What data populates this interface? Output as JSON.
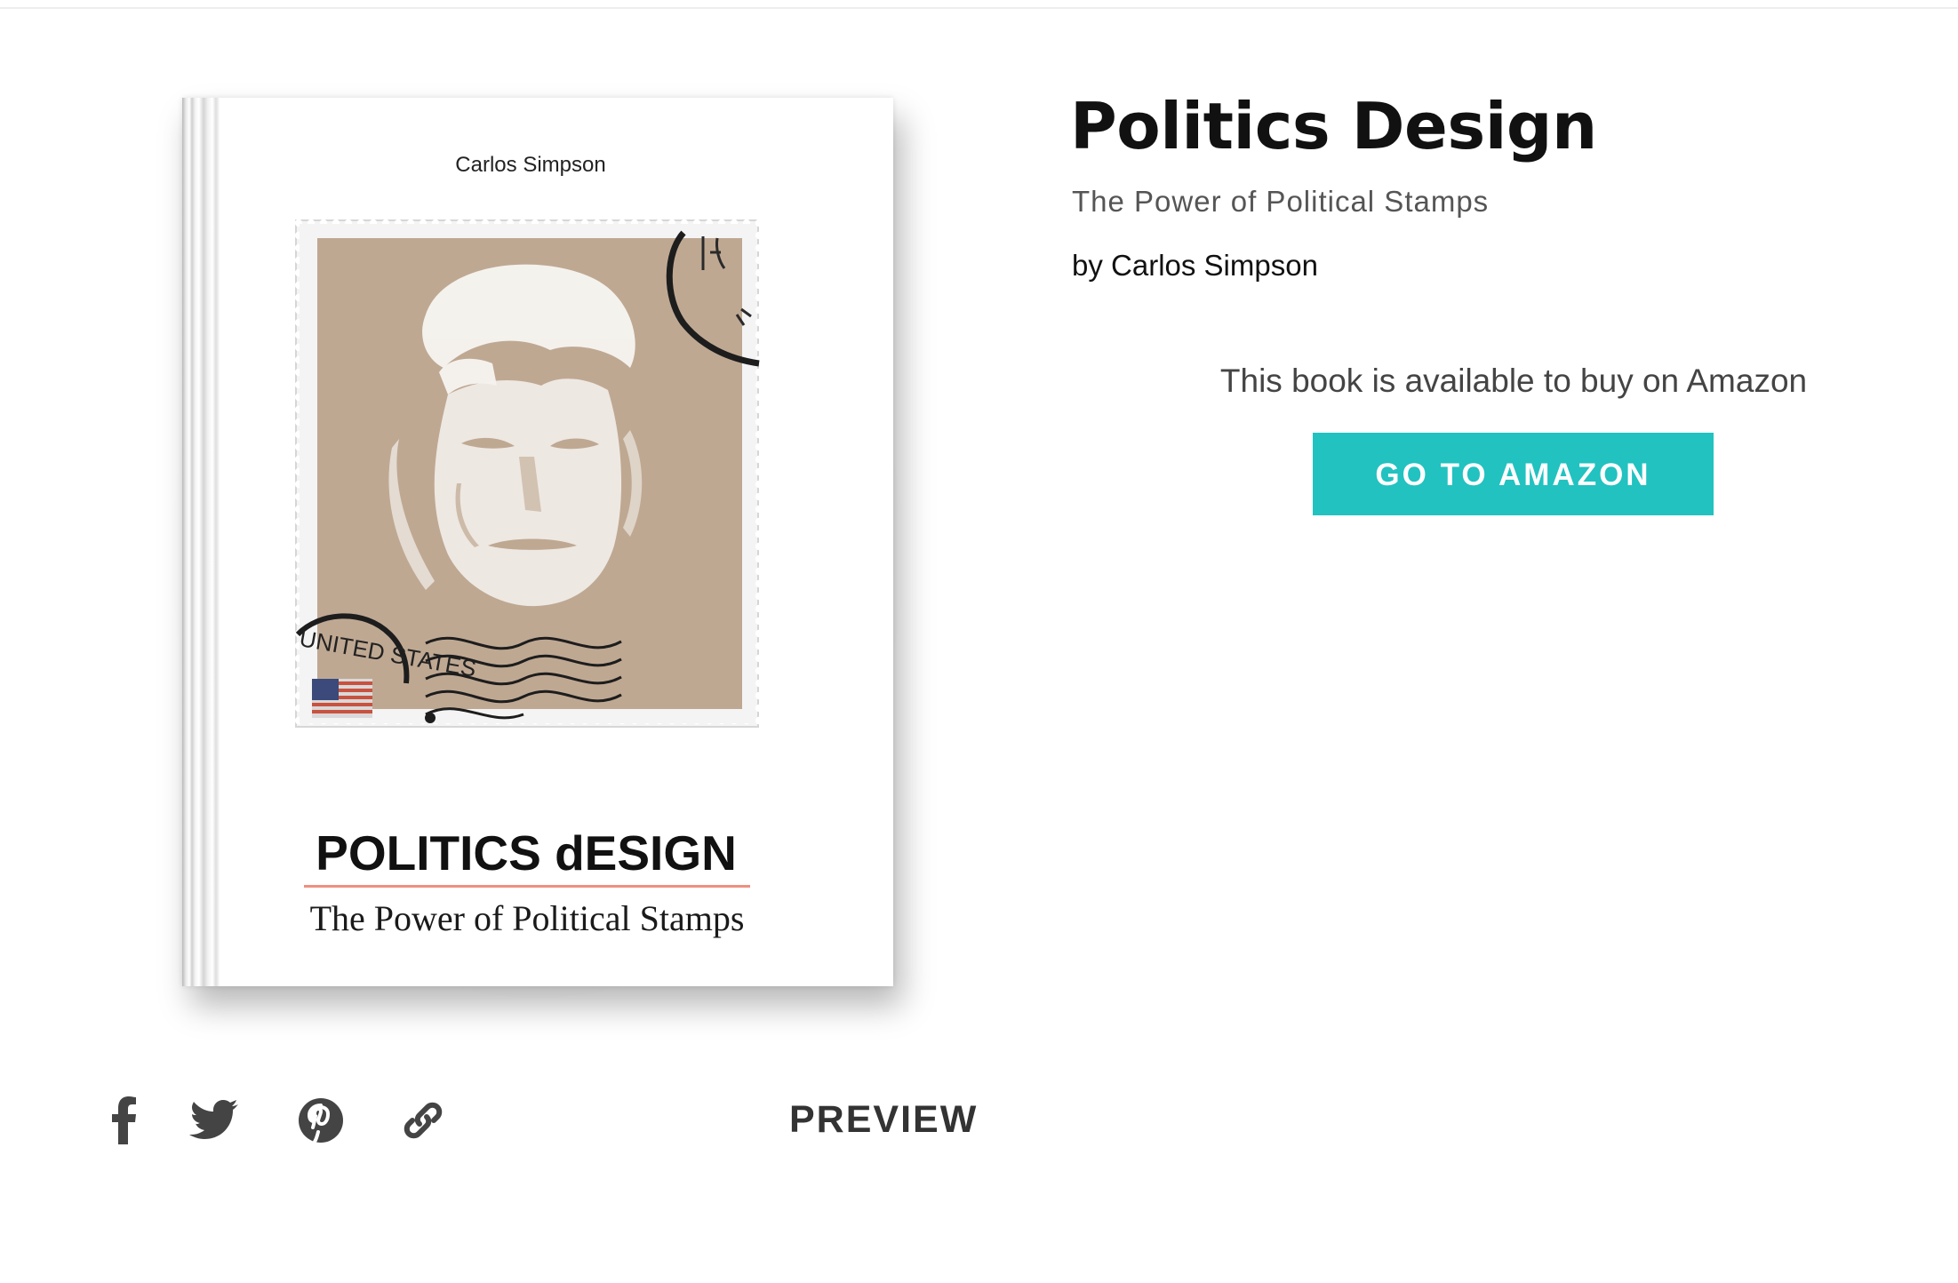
{
  "book_cover": {
    "author": "Carlos Simpson",
    "title": "POLITICS dESIGN",
    "subtitle": "The Power of Political Stamps",
    "stamp_postmark_text": "UNITED STATES",
    "stamp_background_color": "#bfa892",
    "title_rule_color": "#ef8f80"
  },
  "share": {
    "icons": [
      "facebook-icon",
      "twitter-icon",
      "pinterest-icon",
      "link-icon"
    ],
    "icon_color": "#444444",
    "preview_label": "PREVIEW"
  },
  "info": {
    "title": "Politics Design",
    "subtitle": "The Power of Political Stamps",
    "author_line": "by Carlos Simpson",
    "availability_text": "This book is available to buy on Amazon",
    "button_label": "GO TO AMAZON",
    "button_color": "#21c2c0"
  }
}
